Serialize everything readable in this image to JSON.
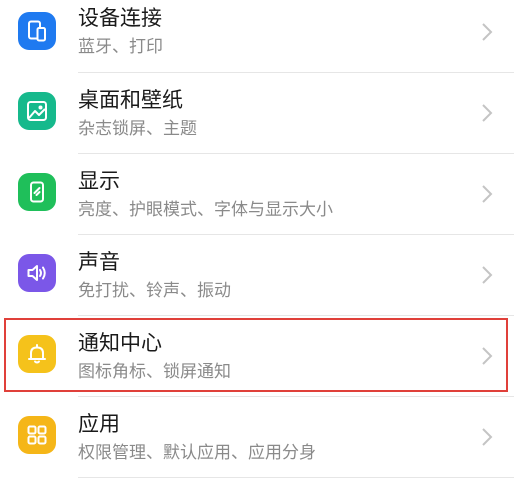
{
  "settings": [
    {
      "title": "设备连接",
      "subtitle": "蓝牙、打印",
      "icon": "device-connection-icon",
      "color": "#1f7af0"
    },
    {
      "title": "桌面和壁纸",
      "subtitle": "杂志锁屏、主题",
      "icon": "wallpaper-icon",
      "color": "#16b98c"
    },
    {
      "title": "显示",
      "subtitle": "亮度、护眼模式、字体与显示大小",
      "icon": "display-icon",
      "color": "#1fbf5a"
    },
    {
      "title": "声音",
      "subtitle": "免打扰、铃声、振动",
      "icon": "sound-icon",
      "color": "#7b57e8"
    },
    {
      "title": "通知中心",
      "subtitle": "图标角标、锁屏通知",
      "icon": "bell-icon",
      "color": "#f5c21b"
    },
    {
      "title": "应用",
      "subtitle": "权限管理、默认应用、应用分身",
      "icon": "apps-icon",
      "color": "#f5b618"
    }
  ],
  "highlight_color": "#e0403a"
}
